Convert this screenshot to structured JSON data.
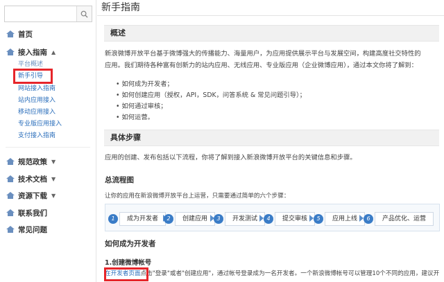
{
  "sidebar": {
    "search": {
      "placeholder": "",
      "value": ""
    },
    "items": [
      {
        "label": "首页",
        "icon": "home-icon"
      },
      {
        "label": "接入指南",
        "icon": "home-icon",
        "expanded": true,
        "children": [
          "平台概述",
          "新手引导",
          "网站接入指南",
          "站内应用接入",
          "移动应用接入",
          "专业版应用接入",
          "支付接入指南"
        ]
      },
      {
        "label": "规范政策",
        "icon": "home-icon"
      },
      {
        "label": "技术文档",
        "icon": "home-icon"
      },
      {
        "label": "资源下载",
        "icon": "home-icon"
      },
      {
        "label": "联系我们",
        "icon": "home-icon"
      },
      {
        "label": "常见问题",
        "icon": "home-icon"
      }
    ]
  },
  "main": {
    "title": "新手指南",
    "overview": {
      "heading": "概述",
      "para1": "新浪微博开放平台基于微博强大的传播能力、海量用户，为应用提供展示平台与发展空间，构建高度社交特性的",
      "para2": "应用。我们期待各种富有创新力的站内应用、无线应用、专业版应用（企业微博应用），通过本文你将了解到：",
      "bullets": [
        "如何成为开发者；",
        "如何创建应用（授权，API，SDK，问答系统 & 常见问题引导）；",
        "如何通过审核；",
        "如何运营。"
      ]
    },
    "steps_section": {
      "heading": "具体步骤",
      "intro": "应用的创建、发布包括以下流程，你将了解到接入新浪微博开放平台的关键信息和步骤。",
      "flow_title": "总流程图",
      "flow_intro": "让你的应用在新浪微博开放平台上运营，只需要通过简单的六个步骤：",
      "steps": [
        {
          "num": "1",
          "label": "成为开发者"
        },
        {
          "num": "2",
          "label": "创建应用"
        },
        {
          "num": "3",
          "label": "开发测试"
        },
        {
          "num": "4",
          "label": "提交审核"
        },
        {
          "num": "5",
          "label": "应用上线"
        },
        {
          "num": "6",
          "label": "产品优化、运营"
        }
      ]
    },
    "developer": {
      "heading": "如何成为开发者",
      "sub": "1.创建微博帐号",
      "line_link": "在开发者页面",
      "line_rest": "点击\"登录\"或者\"创建应用\"，通过帐号登录成为一名开发者。一个新浪微博帐号可以管理10个不同的应用，建议开"
    }
  },
  "colors": {
    "accent": "#2a6ebb",
    "highlight": "#e6252a",
    "step": "#3a7cc7"
  }
}
